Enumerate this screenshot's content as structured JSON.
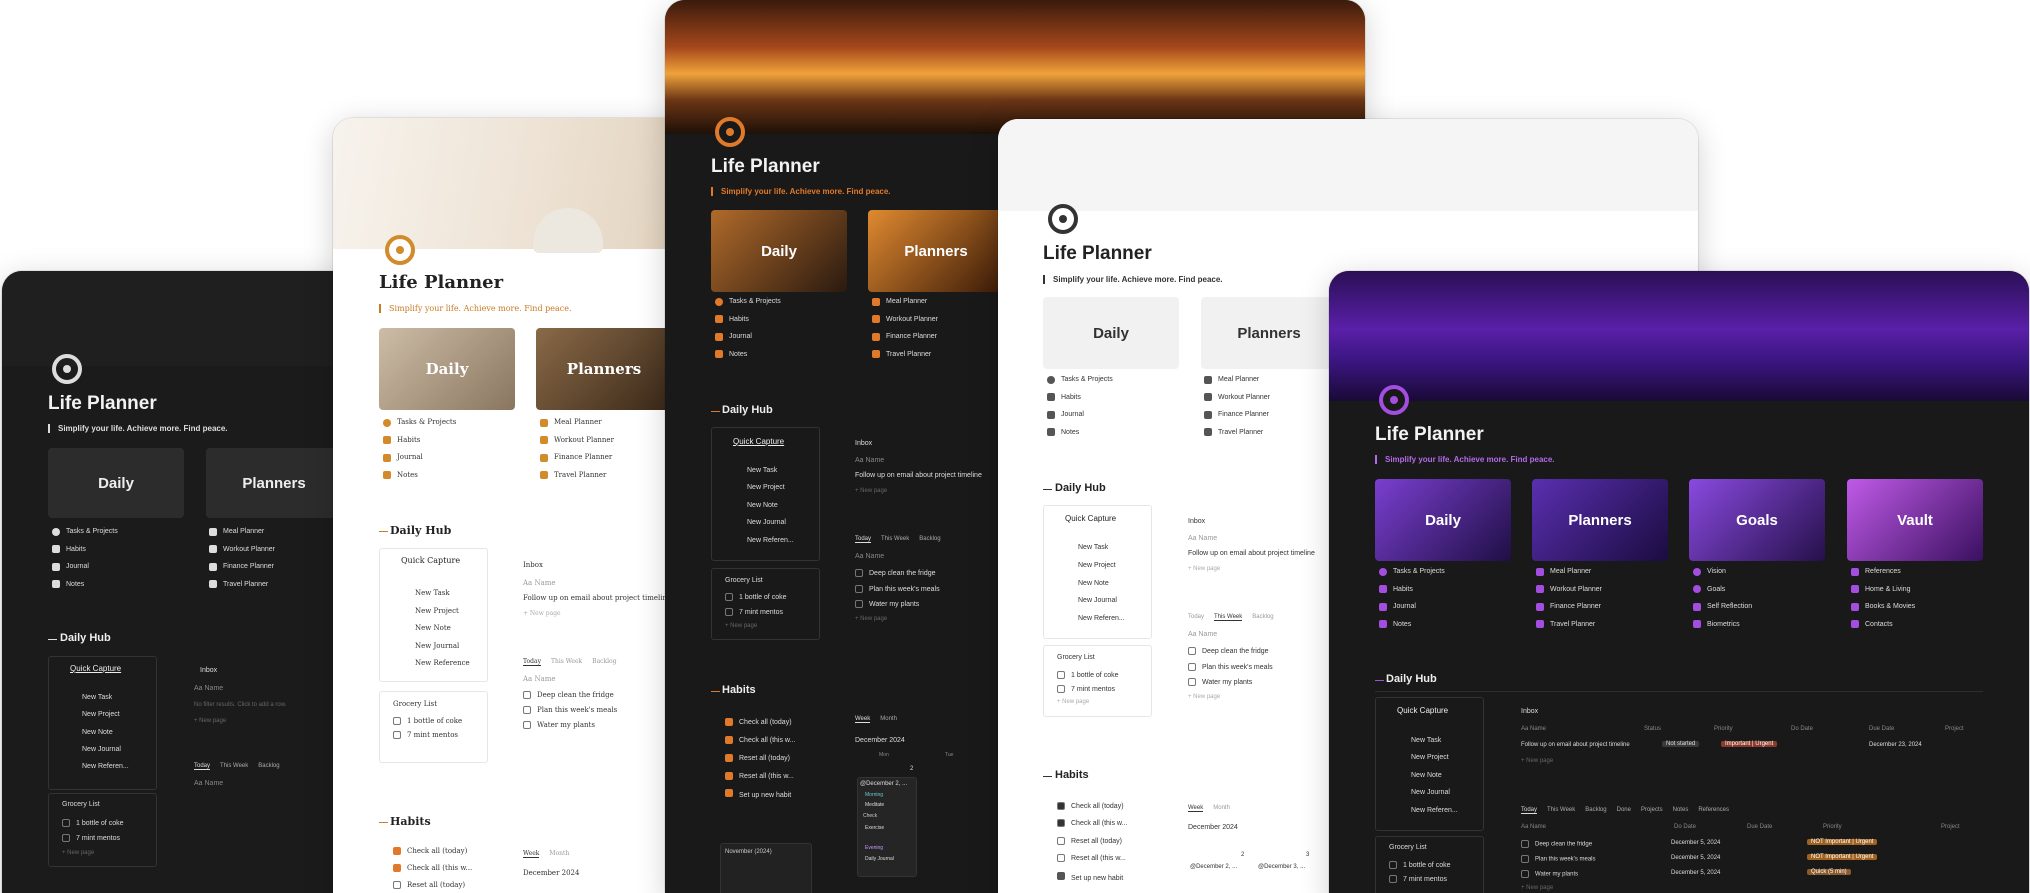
{
  "app_title": "Life Planner",
  "tagline": "Simplify your life. Achieve more. Find peace.",
  "cards": {
    "daily": "Daily",
    "planners": "Planners",
    "goals": "Goals",
    "vault": "Vault"
  },
  "daily_links": [
    "Tasks & Projects",
    "Habits",
    "Journal",
    "Notes"
  ],
  "planner_links": [
    "Meal Planner",
    "Workout Planner",
    "Finance Planner",
    "Travel Planner"
  ],
  "goal_links": [
    "Vision",
    "Goals",
    "Self Reflection",
    "Biometrics"
  ],
  "vault_links": [
    "References",
    "Home & Living",
    "Books & Movies",
    "Contacts"
  ],
  "daily_hub": "Daily Hub",
  "quick_capture": {
    "title": "Quick Capture",
    "items": [
      "New Task",
      "New Project",
      "New Note",
      "New Journal",
      "New Referen...",
      "New Reference"
    ]
  },
  "inbox": {
    "title": "Inbox",
    "name_col": "Aa Name",
    "empty": "No filter results. Click to add a row.",
    "item": "Follow up on email about project timeline",
    "new_page": "+ New page",
    "status_col": "Status",
    "priority_col": "Priority",
    "do_date_col": "Do Date",
    "due_date_col": "Due Date",
    "project_col": "Project",
    "status": "Not started",
    "priority": "Important | Urgent",
    "due": "December 23, 2024"
  },
  "task_tabs": [
    "Today",
    "This Week",
    "Backlog",
    "Done",
    "Projects",
    "Notes",
    "References"
  ],
  "tasks": [
    "Deep clean the fridge",
    "Plan this week's meals",
    "Water my plants"
  ],
  "task_dates": [
    "December 5, 2024",
    "December 5, 2024",
    "December 5, 2024"
  ],
  "task_priorities": [
    "NOT Important | Urgent",
    "NOT Important | Urgent",
    "Quick (5 min)"
  ],
  "grocery": {
    "title": "Grocery List",
    "items": [
      "1 bottle of coke",
      "7 mint mentos"
    ],
    "new_page": "+ New page"
  },
  "habits": {
    "title": "Habits",
    "actions": [
      "Check all (today)",
      "Check all (this w...",
      "Reset all (today)",
      "Reset all (this w...",
      "Set up new habit"
    ]
  },
  "calendar": {
    "tabs": [
      "Week",
      "Month"
    ],
    "month": "December 2024",
    "days": [
      "Mon",
      "Tue"
    ],
    "nums": [
      "2",
      "3"
    ],
    "mini_month": "November (2024)",
    "entries": [
      "@December 2, ...",
      "@December 3, ..."
    ],
    "events": [
      "Morning",
      "Meditate",
      "Check",
      "Exercise",
      "Evening",
      "Daily Journal"
    ]
  },
  "colors": {
    "orange": "#e07a2a",
    "purple": "#a34ee0",
    "dark_bg": "#191919",
    "light_bg": "#ffffff"
  }
}
